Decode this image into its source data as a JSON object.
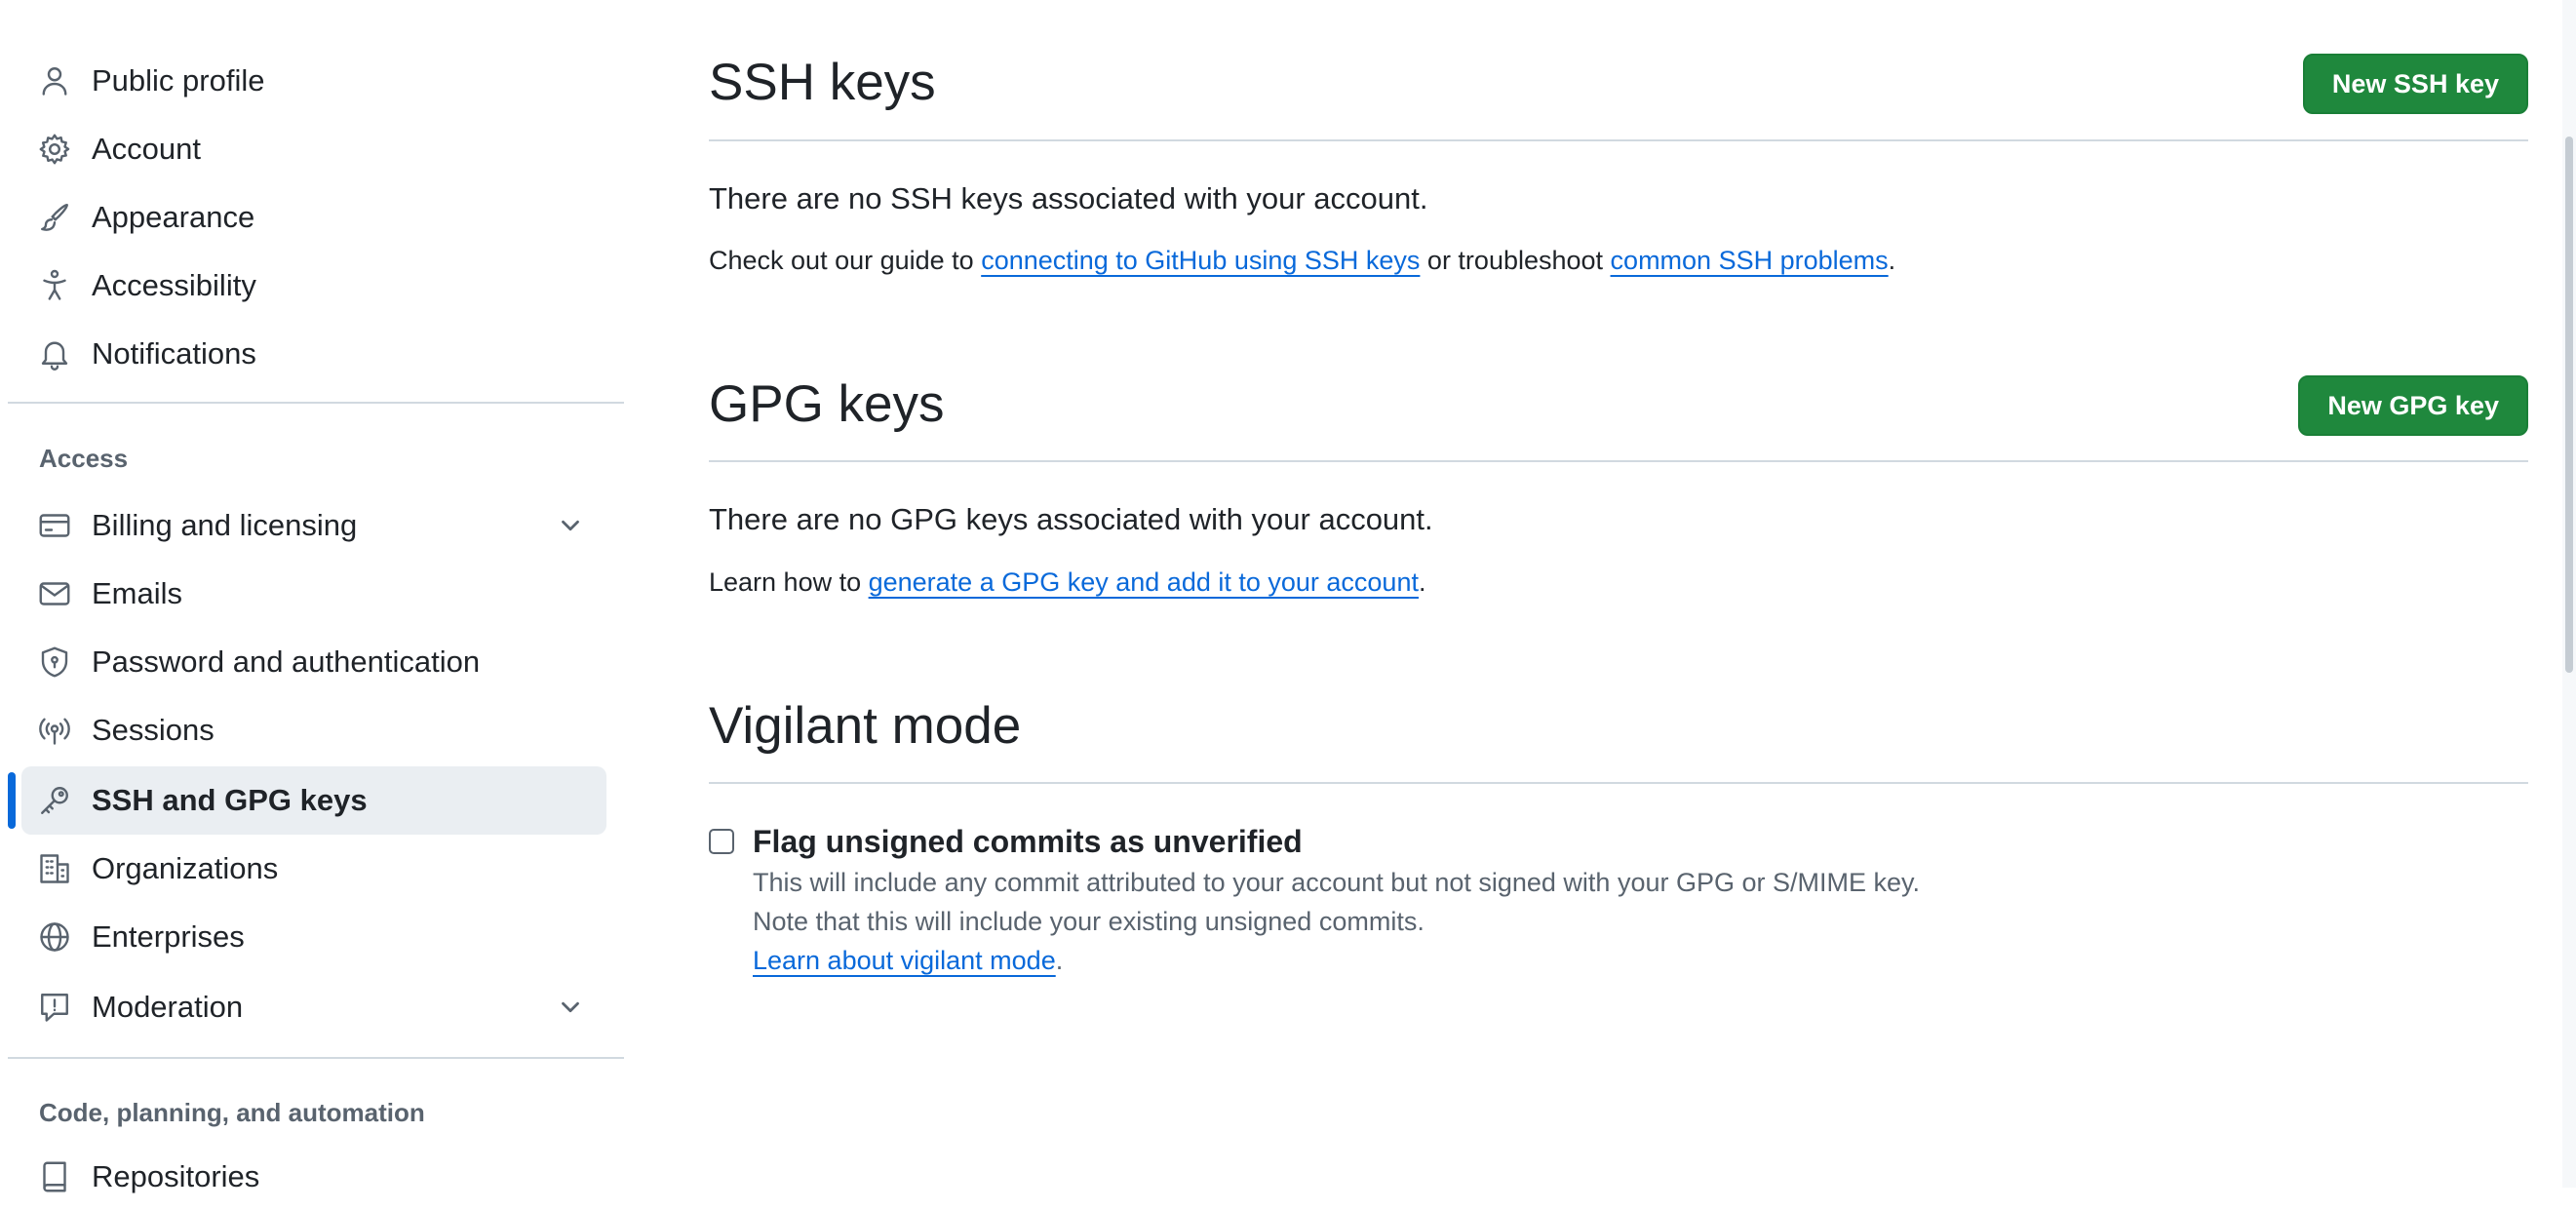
{
  "sidebar": {
    "items_top": [
      {
        "label": "Public profile",
        "icon": "person-icon"
      },
      {
        "label": "Account",
        "icon": "gear-icon"
      },
      {
        "label": "Appearance",
        "icon": "paintbrush-icon"
      },
      {
        "label": "Accessibility",
        "icon": "accessibility-icon"
      },
      {
        "label": "Notifications",
        "icon": "bell-icon"
      }
    ],
    "access_heading": "Access",
    "access_items": [
      {
        "label": "Billing and licensing",
        "icon": "credit-card-icon",
        "expandable": true
      },
      {
        "label": "Emails",
        "icon": "mail-icon"
      },
      {
        "label": "Password and authentication",
        "icon": "shield-lock-icon"
      },
      {
        "label": "Sessions",
        "icon": "broadcast-icon"
      },
      {
        "label": "SSH and GPG keys",
        "icon": "key-icon",
        "active": true
      },
      {
        "label": "Organizations",
        "icon": "organization-icon"
      },
      {
        "label": "Enterprises",
        "icon": "globe-icon"
      },
      {
        "label": "Moderation",
        "icon": "report-icon",
        "expandable": true
      }
    ],
    "code_heading": "Code, planning, and automation",
    "code_items": [
      {
        "label": "Repositories",
        "icon": "repo-icon"
      }
    ]
  },
  "ssh": {
    "title": "SSH keys",
    "button": "New SSH key",
    "empty": "There are no SSH keys associated with your account.",
    "help_prefix": "Check out our guide to ",
    "help_link1": "connecting to GitHub using SSH keys",
    "help_middle": " or troubleshoot ",
    "help_link2": "common SSH problems",
    "help_suffix": "."
  },
  "gpg": {
    "title": "GPG keys",
    "button": "New GPG key",
    "empty": "There are no GPG keys associated with your account.",
    "help_prefix": "Learn how to ",
    "help_link": "generate a GPG key and add it to your account",
    "help_suffix": "."
  },
  "vigilant": {
    "title": "Vigilant mode",
    "checkbox_label": "Flag unsigned commits as unverified",
    "checkbox_checked": false,
    "note_line1": "This will include any commit attributed to your account but not signed with your GPG or S/MIME key.",
    "note_line2": "Note that this will include your existing unsigned commits.",
    "learn_link": "Learn about vigilant mode",
    "learn_suffix": "."
  },
  "colors": {
    "accent": "#0969da",
    "primary_button": "#1f883d",
    "muted_text": "#59636e",
    "border": "#d1d9e0",
    "active_bg": "#eaeef2"
  }
}
